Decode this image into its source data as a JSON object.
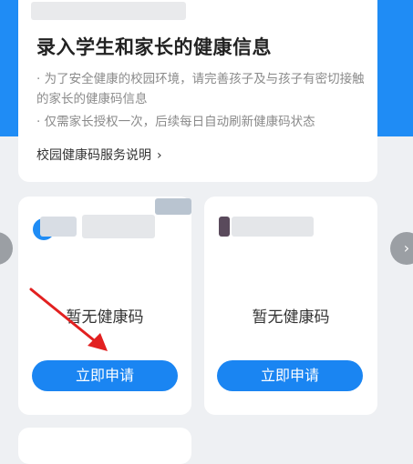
{
  "info_card": {
    "title": "录入学生和家长的健康信息",
    "bullets": [
      "· 为了安全健康的校园环境，请完善孩子及与孩子有密切接触的家长的健康码信息",
      "· 仅需家长授权一次，后续每日自动刷新健康码状态"
    ],
    "service_link": "校园健康码服务说明",
    "chevron_icon": "chevron-right-icon"
  },
  "person_cards": [
    {
      "status": "暂无健康码",
      "button": "立即申请"
    },
    {
      "status": "暂无健康码",
      "button": "立即申请"
    }
  ],
  "nav": {
    "left_icon": "chevron-left-icon",
    "right_icon": "chevron-right-icon"
  },
  "colors": {
    "accent": "#1f8cf5",
    "button": "#1a85f2",
    "arrow_annotation": "#e22020",
    "background": "#eef0f3"
  }
}
